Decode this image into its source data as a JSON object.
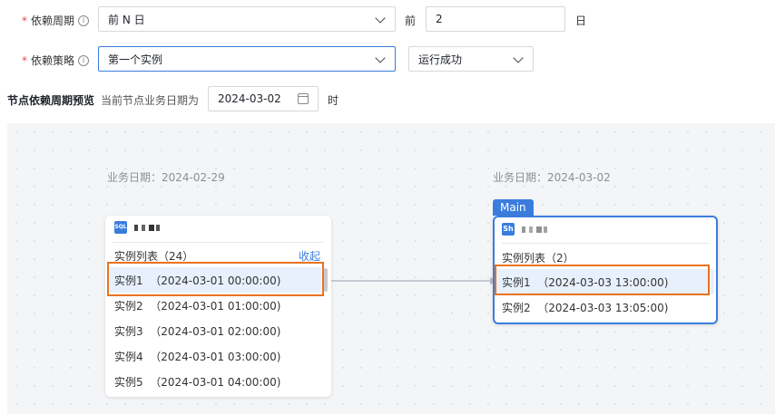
{
  "form": {
    "cycle_label": "依赖周期",
    "cycle_select": "前 N 日",
    "cycle_prefix": "前",
    "cycle_value": "2",
    "cycle_unit": "日",
    "strategy_label": "依赖策略",
    "strategy_select": "第一个实例",
    "strategy_status": "运行成功",
    "required_mark": "*",
    "info_glyph": "i"
  },
  "preview": {
    "title": "节点依赖周期预览",
    "hint": "当前节点业务日期为",
    "date_value": "2024-03-02",
    "time_unit": "时"
  },
  "left_node": {
    "biz_date": "业务日期：2024-02-29",
    "type_badge": "SQL",
    "list_header": "实例列表（24）",
    "collapse": "收起",
    "instances": [
      "实例1  （2024-03-01 00:00:00)",
      "实例2  （2024-03-01 01:00:00)",
      "实例3  （2024-03-01 02:00:00)",
      "实例4  （2024-03-01 03:00:00)",
      "实例5  （2024-03-01 04:00:00)"
    ]
  },
  "right_node": {
    "biz_date": "业务日期：2024-03-02",
    "tag": "Main",
    "type_badge": "Sh",
    "list_header": "实例列表（2）",
    "instances": [
      "实例1  （2024-03-03 13:00:00)",
      "实例2  （2024-03-03 13:05:00)"
    ]
  },
  "colors": {
    "accent": "#3b7ddd",
    "highlight": "#e8731e",
    "required": "#e5484d"
  }
}
